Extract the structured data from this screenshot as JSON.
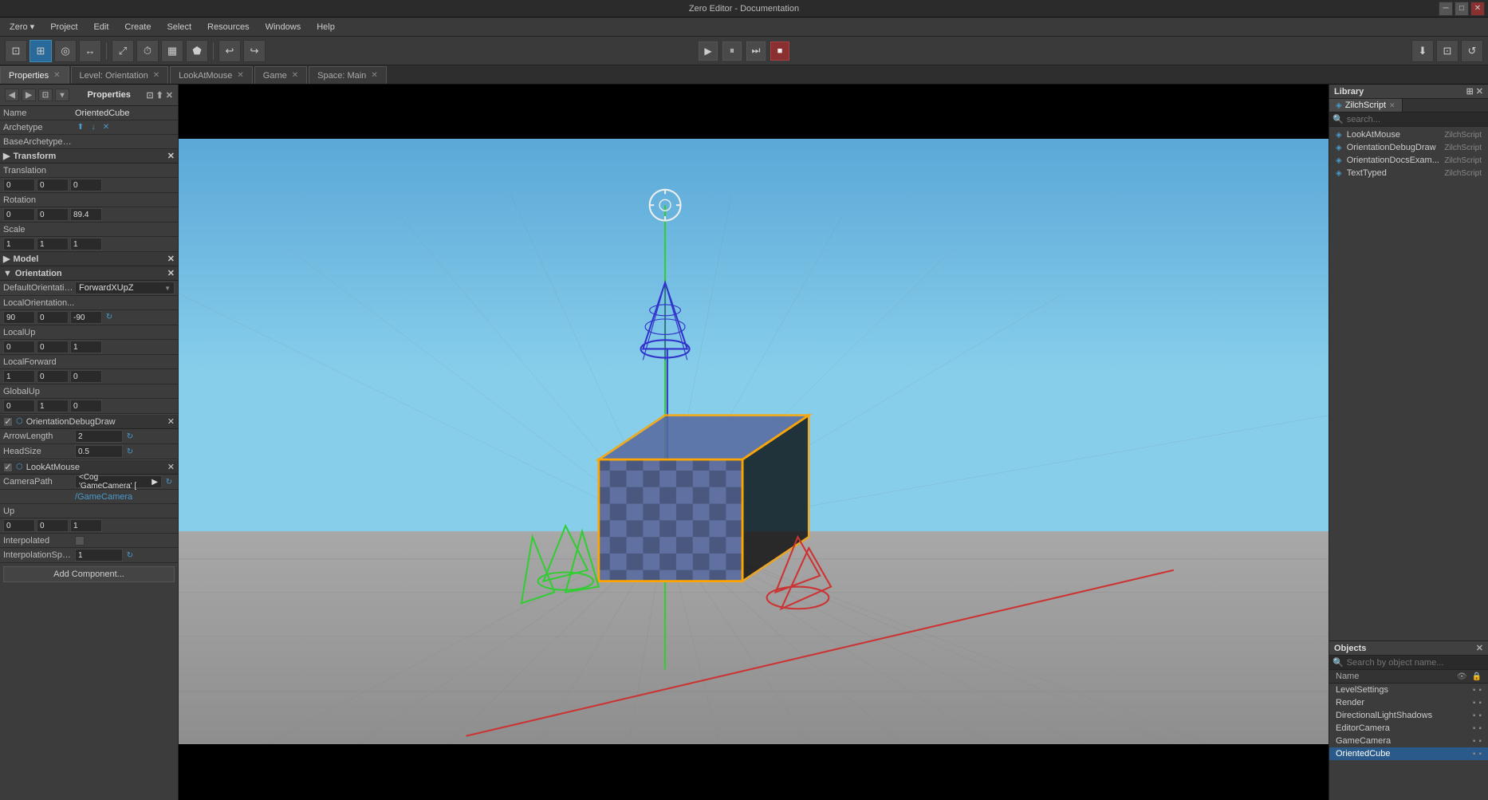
{
  "titleBar": {
    "title": "Zero Editor - Documentation",
    "minimizeLabel": "─",
    "maximizeLabel": "□",
    "closeLabel": "✕"
  },
  "menuBar": {
    "items": [
      "Zero",
      "Project",
      "Edit",
      "Create",
      "Select",
      "Resources",
      "Windows",
      "Help"
    ]
  },
  "toolbar": {
    "leftButtons": [
      "⊡",
      "⊞",
      "◎",
      "⟲",
      "↔",
      "⤢",
      "⏱",
      "▶",
      "↩"
    ],
    "playLabel": "▶",
    "pauseLabel": "⏸",
    "stepLabel": "⏭",
    "stopLabel": "■",
    "rightButtons": [
      "⬇",
      "⊡",
      "↺"
    ]
  },
  "tabs": [
    {
      "label": "Properties",
      "active": true,
      "closable": true
    },
    {
      "label": "Level: Orientation",
      "active": false,
      "closable": true
    },
    {
      "label": "LookAtMouse",
      "active": false,
      "closable": true
    },
    {
      "label": "Game",
      "active": false,
      "closable": true
    },
    {
      "label": "Space: Main",
      "active": false,
      "closable": true
    }
  ],
  "properties": {
    "name": "OrientedCube",
    "archetype": "",
    "baseArchetypeName": "",
    "transform": {
      "translation": {
        "x": "0",
        "y": "0",
        "z": "0"
      },
      "rotation": {
        "x": "0",
        "y": "0",
        "z": "89.4"
      },
      "scale": {
        "x": "1",
        "y": "1",
        "z": "1"
      }
    },
    "orientation": {
      "defaultOrientation": "ForwardXUpZ",
      "localOrientation": {
        "x": "90",
        "y": "0",
        "z": "-90"
      },
      "localUp": {
        "x": "0",
        "y": "0",
        "z": "1"
      },
      "localForward": {
        "x": "1",
        "y": "0",
        "z": "0"
      },
      "globalUp": {
        "x": "0",
        "y": "1",
        "z": "0"
      }
    },
    "orientationDebugDraw": {
      "arrowLength": "2",
      "headSize": "0.5"
    },
    "lookAtMouse": {
      "cameraPath": "<Cog 'GameCamera' [",
      "gameCameraPath": "/GameCamera",
      "up": {
        "x": "0",
        "y": "0",
        "z": "1"
      },
      "interpolated": false,
      "interpolationSpeed": "1"
    }
  },
  "library": {
    "title": "Library",
    "searchPlaceholder": "search...",
    "tabs": [
      {
        "label": "ZilchScript",
        "active": true
      }
    ],
    "items": [
      {
        "name": "LookAtMouse",
        "type": "ZilchScript"
      },
      {
        "name": "OrientationDebugDraw",
        "type": "ZilchScript"
      },
      {
        "name": "OrientationDocsExam...",
        "type": "ZilchScript"
      },
      {
        "name": "TextTyped",
        "type": "ZilchScript"
      }
    ]
  },
  "objects": {
    "title": "Objects",
    "searchPlaceholder": "Search by object name...",
    "columnName": "Name",
    "items": [
      {
        "name": "LevelSettings",
        "selected": false
      },
      {
        "name": "Render",
        "selected": false
      },
      {
        "name": "DirectionalLightShadows",
        "selected": false
      },
      {
        "name": "EditorCamera",
        "selected": false
      },
      {
        "name": "GameCamera",
        "selected": false
      },
      {
        "name": "OrientedCube",
        "selected": true
      }
    ]
  },
  "addComponentLabel": "Add Component...",
  "icons": {
    "search": "🔍",
    "close": "✕",
    "arrow_down": "▼",
    "arrow_right": "▶",
    "refresh": "↻",
    "eye": "👁",
    "lock": "🔒",
    "check": "✓",
    "grid": "⊞"
  },
  "colors": {
    "accent": "#2a6a9a",
    "selected": "#2a5a8a",
    "refresh": "#4a9aca"
  }
}
